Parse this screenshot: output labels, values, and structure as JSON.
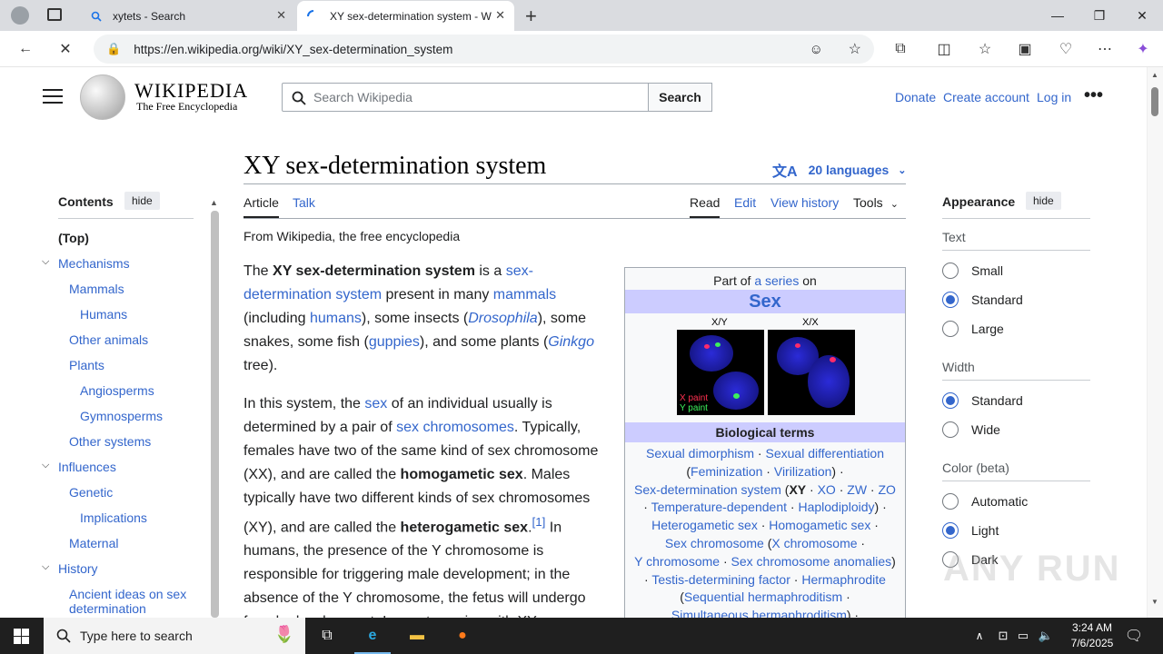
{
  "browser": {
    "tabs": [
      {
        "title": "xytets - Search",
        "active": false
      },
      {
        "title": "XY sex-determination system - W",
        "active": true
      }
    ],
    "url": "https://en.wikipedia.org/wiki/XY_sex-determination_system"
  },
  "header": {
    "wordmark": "WIKIPEDIA",
    "tagline": "The Free Encyclopedia",
    "search_placeholder": "Search Wikipedia",
    "search_button": "Search",
    "donate": "Donate",
    "create_account": "Create account",
    "login": "Log in"
  },
  "article": {
    "title": "XY sex-determination system",
    "languages": "20 languages",
    "tabs": {
      "article": "Article",
      "talk": "Talk",
      "read": "Read",
      "edit": "Edit",
      "history": "View history",
      "tools": "Tools"
    },
    "from": "From Wikipedia, the free encyclopedia"
  },
  "toc": {
    "heading": "Contents",
    "hide": "hide",
    "items": [
      {
        "label": "(Top)"
      },
      {
        "label": "Mechanisms"
      },
      {
        "label": "Mammals"
      },
      {
        "label": "Humans"
      },
      {
        "label": "Other animals"
      },
      {
        "label": "Plants"
      },
      {
        "label": "Angiosperms"
      },
      {
        "label": "Gymnosperms"
      },
      {
        "label": "Other systems"
      },
      {
        "label": "Influences"
      },
      {
        "label": "Genetic"
      },
      {
        "label": "Implications"
      },
      {
        "label": "Maternal"
      },
      {
        "label": "History"
      },
      {
        "label": "Ancient ideas on sex determination"
      }
    ]
  },
  "infobox": {
    "part_of_pre": "Part of",
    "part_of_link": "a series",
    "part_of_post": "on",
    "title": "Sex",
    "caption_left": "X/Y",
    "caption_right": "X/X",
    "paint_x": "X paint",
    "paint_y": "Y paint",
    "section": "Biological terms"
  },
  "appearance": {
    "heading": "Appearance",
    "hide": "hide",
    "text_label": "Text",
    "text_options": [
      "Small",
      "Standard",
      "Large"
    ],
    "width_label": "Width",
    "width_options": [
      "Standard",
      "Wide"
    ],
    "color_label": "Color (beta)",
    "color_options": [
      "Automatic",
      "Light",
      "Dark"
    ]
  },
  "taskbar": {
    "search_placeholder": "Type here to search",
    "time": "3:24 AM",
    "date": "7/6/2025"
  },
  "watermark": "ANY RUN"
}
